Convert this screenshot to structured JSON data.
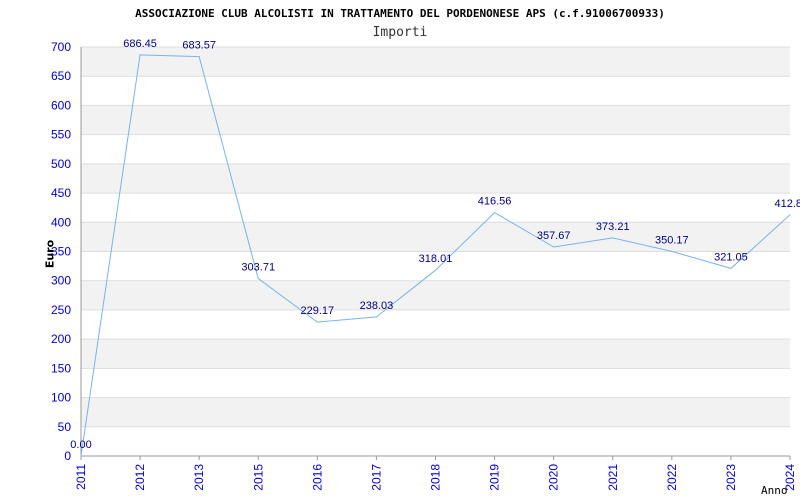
{
  "title": "ASSOCIAZIONE CLUB ALCOLISTI IN TRATTAMENTO DEL PORDENONESE APS (c.f.91006700933)",
  "subtitle": "Importi",
  "colors": {
    "line": "#7ab3e8",
    "tick_text": "#0000cc",
    "label_text": "#000080",
    "band": "#f2f2f2",
    "grid": "#dddddd"
  },
  "chart_data": {
    "type": "line",
    "xlabel": "Anno",
    "ylabel": "Euro",
    "ylim": [
      0,
      700
    ],
    "yticks": [
      0,
      50,
      100,
      150,
      200,
      250,
      300,
      350,
      400,
      450,
      500,
      550,
      600,
      650,
      700
    ],
    "grid": true,
    "x": [
      "2011",
      "2012",
      "2013",
      "2015",
      "2016",
      "2017",
      "2018",
      "2019",
      "2020",
      "2021",
      "2022",
      "2023",
      "2024"
    ],
    "values": [
      0,
      686.45,
      683.57,
      303.71,
      229.17,
      238.03,
      318.01,
      416.56,
      357.67,
      373.21,
      350.17,
      321.05,
      412.8
    ],
    "data_labels": [
      "0.00",
      "686.45",
      "683.57",
      "303.71",
      "229.17",
      "238.03",
      "318.01",
      "416.56",
      "357.67",
      "373.21",
      "350.17",
      "321.05",
      "412.8"
    ]
  }
}
